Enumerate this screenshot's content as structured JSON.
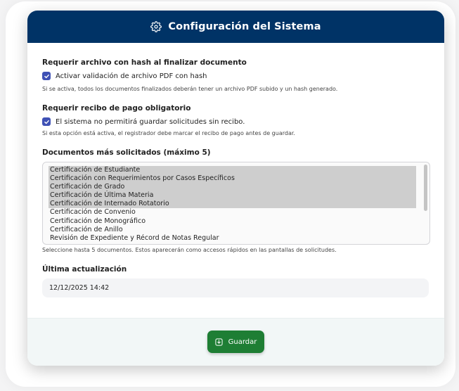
{
  "header": {
    "title": "Configuración del Sistema",
    "icon": "gear-icon"
  },
  "hash_section": {
    "title": "Requerir archivo con hash al finalizar documento",
    "checkbox_label": "Activar validación de archivo PDF con hash",
    "checked": true,
    "help": "Si se activa, todos los documentos finalizados deberán tener un archivo PDF subido y un hash generado."
  },
  "receipt_section": {
    "title": "Requerir recibo de pago obligatorio",
    "checkbox_label": "El sistema no permitirá guardar solicitudes sin recibo.",
    "checked": true,
    "help": "Si esta opción está activa, el registrador debe marcar el recibo de pago antes de guardar."
  },
  "documents_section": {
    "title": "Documentos más solicitados (máximo 5)",
    "options": [
      {
        "label": "Certificación de Estudiante",
        "selected": true
      },
      {
        "label": "Certificación con Requerimientos por Casos Específicos",
        "selected": true
      },
      {
        "label": "Certificación de Grado",
        "selected": true
      },
      {
        "label": "Certificación de Última Materia",
        "selected": true
      },
      {
        "label": "Certificación de Internado Rotatorio",
        "selected": true
      },
      {
        "label": "Certificación de Convenio",
        "selected": false
      },
      {
        "label": "Certificación de Monográfico",
        "selected": false
      },
      {
        "label": "Certificación de Anillo",
        "selected": false
      },
      {
        "label": "Revisión de Expediente y Récord de Notas Regular",
        "selected": false
      }
    ],
    "help": "Seleccione hasta 5 documentos. Estos aparecerán como accesos rápidos en las pantallas de solicitudes."
  },
  "last_update": {
    "title": "Última actualización",
    "value": "12/12/2025 14:42"
  },
  "footer": {
    "save_label": "Guardar",
    "save_icon": "save-icon"
  },
  "colors": {
    "header_bg": "#003366",
    "checkbox": "#3f51b5",
    "save_button": "#1e7e34",
    "selected_option": "#cecece"
  }
}
